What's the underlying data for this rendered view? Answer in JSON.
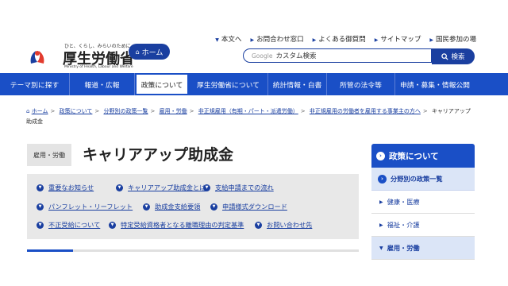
{
  "header": {
    "tagline": "ひと、くらし、みらいのために",
    "site_name": "厚生労働省",
    "site_name_en": "Ministry of Health, Labour and Welfare",
    "home_label": "ホーム",
    "utility_links": [
      "本文へ",
      "お問合わせ窓口",
      "よくある御質問",
      "サイトマップ",
      "国民参加の場"
    ],
    "search_brand": "Google",
    "search_placeholder": "カスタム検索",
    "search_button": "検索"
  },
  "nav": {
    "items": [
      {
        "label": "テーマ別に探す"
      },
      {
        "label": "報道・広報"
      },
      {
        "label": "政策について",
        "active": true
      },
      {
        "label": "厚生労働省について"
      },
      {
        "label": "統計情報・白書"
      },
      {
        "label": "所管の法令等"
      },
      {
        "label": "申請・募集・情報公開"
      }
    ]
  },
  "breadcrumb": {
    "items": [
      "ホーム",
      "政策について",
      "分野別の政策一覧",
      "雇用・労働",
      "非正規雇用（有期・パート・派遣労働）",
      "非正規雇用の労働者を雇用する事業主の方へ"
    ],
    "current": "キャリアアップ助成金"
  },
  "page": {
    "category": "雇用・労働",
    "title": "キャリアアップ助成金"
  },
  "anchor_links": [
    "重要なお知らせ",
    "キャリアアップ助成金とは",
    "支給申請までの流れ",
    "パンフレット・リーフレット",
    "助成金支給要領",
    "申請様式ダウンロード",
    "不正受給について",
    "特定受給資格者となる離職理由の判定基準",
    "お問い合わせ先"
  ],
  "side_menu": {
    "title": "政策について",
    "sub": "分野別の政策一覧",
    "items": [
      {
        "label": "健康・医療"
      },
      {
        "label": "福祉・介護"
      },
      {
        "label": "雇用・労働",
        "selected": true
      }
    ]
  },
  "colors": {
    "brand_blue": "#1a4fc6",
    "dark_blue": "#1a3fa0"
  }
}
